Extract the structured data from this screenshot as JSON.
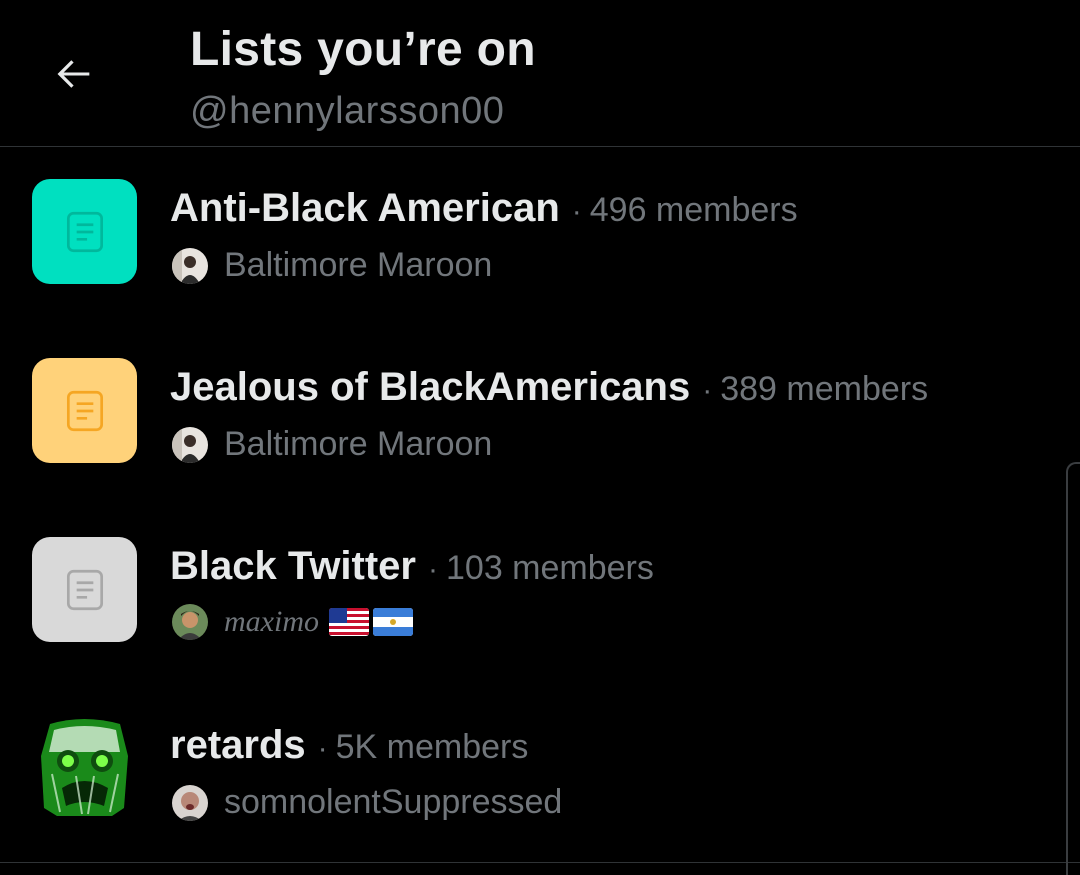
{
  "header": {
    "title": "Lists you’re on",
    "handle": "@hennylarsson00"
  },
  "icons": {
    "back": "arrow-left-icon",
    "list": "list-document-icon"
  },
  "lists": [
    {
      "name": "Anti-Black American",
      "separator": "·",
      "members": "496 members",
      "owner": "Baltimore Maroon",
      "thumb_color": "#00e0c0"
    },
    {
      "name": "Jealous of BlackAmericans",
      "separator": "·",
      "members": "389 members",
      "owner": "Baltimore Maroon",
      "thumb_color": "#ffd27a"
    },
    {
      "name": "Black Twitter",
      "separator": "·",
      "members": "103 members",
      "owner": "maximo",
      "owner_flags": [
        "us-flag",
        "nicaragua-flag"
      ],
      "thumb_color": "#d9d9d9"
    },
    {
      "name": "retards",
      "separator": "·",
      "members": "5K members",
      "owner": "somnolentSuppressed",
      "thumb_color": "#1a9a1a"
    }
  ],
  "colors": {
    "background": "#000000",
    "primary_text": "#e7e9ea",
    "secondary_text": "#71767b",
    "divider": "#2f3336"
  }
}
